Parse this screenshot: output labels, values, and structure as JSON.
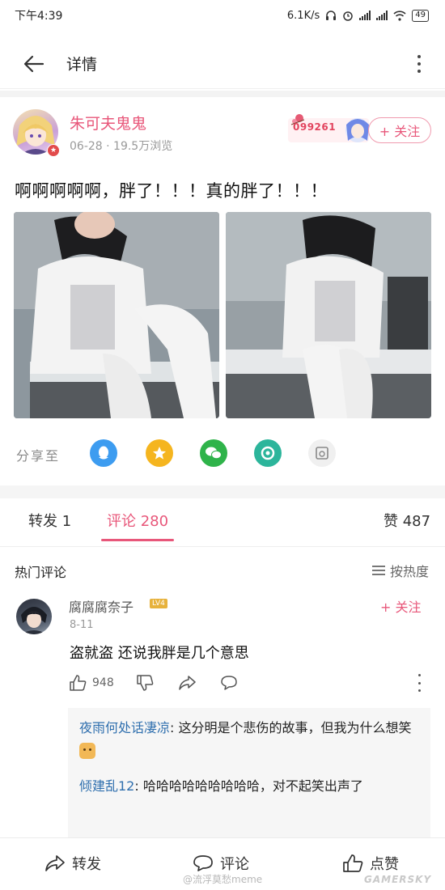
{
  "status_bar": {
    "time": "下午4:39",
    "net_speed": "6.1K/s",
    "battery": "49"
  },
  "header": {
    "title": "详情"
  },
  "post": {
    "author": "朱可夫鬼鬼",
    "meta": "06-28 · 19.5万浏览",
    "decor_number": "099261",
    "follow_label": "+ 关注",
    "text": "啊啊啊啊啊，胖了！！！真的胖了！！！"
  },
  "share": {
    "label": "分享至",
    "targets": [
      "qq-icon",
      "qzone-icon",
      "wechat-icon",
      "moments-icon",
      "weibo-icon"
    ],
    "colors": [
      "#3d9cf0",
      "#f5b51f",
      "#2fb34a",
      "#2cb59b",
      "#f0f0f0"
    ]
  },
  "tabs": {
    "forward": "转发 1",
    "comments": "评论 280",
    "likes": "赞 487"
  },
  "comments_section": {
    "title": "热门评论",
    "sort_label": "按热度"
  },
  "comment": {
    "name": "腐腐腐奈子",
    "level": "LV4",
    "date": "8-11",
    "follow_label": "+ 关注",
    "text": "盗就盗 还说我胖是几个意思",
    "like_count": "948"
  },
  "replies": [
    {
      "name": "夜雨何处话凄凉",
      "text": ": 这分明是个悲伤的故事，但我为什么想笑"
    },
    {
      "name": "倾建乱12",
      "text": ": 哈哈哈哈哈哈哈哈哈，对不起笑出声了"
    }
  ],
  "bottom_bar": {
    "forward": "转发",
    "comment": "评论",
    "like": "点赞"
  },
  "watermark": "@流浮莫愁meme",
  "watermark_site": "GAMERSKY",
  "colors": {
    "accent": "#e8577a",
    "reply_name": "#2f6fae"
  }
}
